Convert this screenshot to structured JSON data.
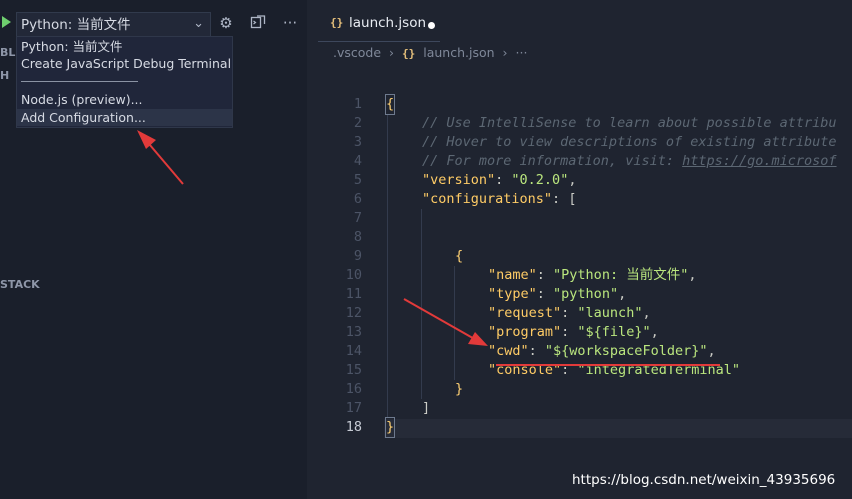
{
  "colors": {
    "accent_red": "#e23a3a",
    "key": "#ffcc66",
    "string": "#bae67e",
    "comment": "#5c6773"
  },
  "debug_toolbar": {
    "selected_config": "Python: 当前文件",
    "icons": [
      "play-icon",
      "chevron-down-icon",
      "gear-icon",
      "terminal-icon",
      "more-icon"
    ]
  },
  "config_dropdown": {
    "items": [
      "Python: 当前文件",
      "Create JavaScript Debug Terminal",
      "Node.js (preview)...",
      "Add Configuration..."
    ]
  },
  "sidebar": {
    "sections": [
      "BL",
      "H",
      "STACK"
    ]
  },
  "tab": {
    "title": "launch.json",
    "dirty": true
  },
  "breadcrumb": {
    "folder": ".vscode",
    "file_icon": "{}",
    "file": "launch.json",
    "more": "···"
  },
  "editor": {
    "active_line": 18,
    "line_numbers": [
      "1",
      "2",
      "3",
      "4",
      "5",
      "6",
      "7",
      "8",
      "9",
      "10",
      "11",
      "12",
      "13",
      "14",
      "15",
      "16",
      "17",
      "18"
    ],
    "lines": {
      "l1": "{",
      "l2": "// Use IntelliSense to learn about possible attribu",
      "l3": "// Hover to view descriptions of existing attribute",
      "l4_prefix": "// For more information, visit: ",
      "l4_link": "https://go.microsof",
      "l5_key": "\"version\"",
      "l5_val": "\"0.2.0\"",
      "l6_key": "\"configurations\"",
      "l6_tail": "[",
      "l9": "{",
      "l10_key": "\"name\"",
      "l10_val": "\"Python: 当前文件\"",
      "l11_key": "\"type\"",
      "l11_val": "\"python\"",
      "l12_key": "\"request\"",
      "l12_val": "\"launch\"",
      "l13_key": "\"program\"",
      "l13_val": "\"${file}\"",
      "l14_key": "\"cwd\"",
      "l14_val": "\"${workspaceFolder}\"",
      "l15_key": "\"console\"",
      "l15_val": "\"integratedTerminal\"",
      "l16": "}",
      "l17": "]",
      "l18": "}"
    }
  },
  "watermark": "https://blog.csdn.net/weixin_43935696"
}
